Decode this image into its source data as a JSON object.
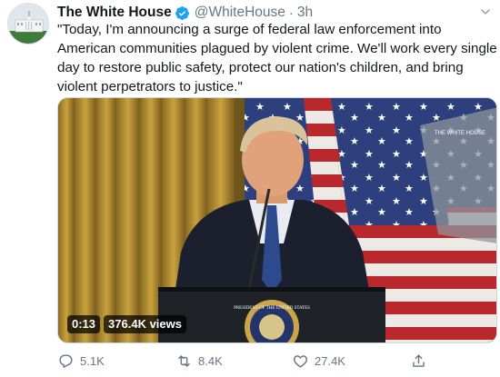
{
  "tweet": {
    "author_name": "The White House",
    "handle": "@WhiteHouse",
    "separator": "·",
    "time": "3h",
    "text": "\"Today, I'm announcing a surge of federal law enforcement into American communities plagued by violent crime. We'll work every single day to restore public safety, protect our nation's children, and bring violent perpetrators to justice.\""
  },
  "media": {
    "duration": "0:13",
    "views": "376.4K views",
    "podium_seal_text": "PRESIDENT OF THE UNITED STATES",
    "prompter_text": "THE WHITE HOUSE"
  },
  "actions": {
    "replies": "5.1K",
    "retweets": "8.4K",
    "likes": "27.4K"
  },
  "colors": {
    "verified": "#1da1f2",
    "muted_text": "#657786",
    "text": "#14171a"
  },
  "icons": {
    "verified": "verified-badge-icon",
    "caret": "chevron-down-icon",
    "reply": "reply-icon",
    "retweet": "retweet-icon",
    "like": "heart-icon",
    "share": "share-icon"
  }
}
